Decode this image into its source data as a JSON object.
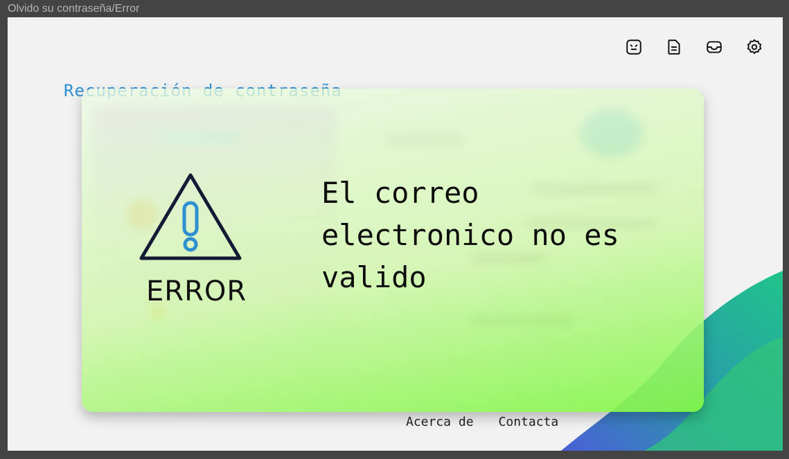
{
  "window": {
    "title": "Olvido su contraseña/Error"
  },
  "toolbar": {
    "icons": [
      "face-icon",
      "document-icon",
      "inbox-icon",
      "settings-gear-icon"
    ]
  },
  "page": {
    "title": "Recuperación de contraseña"
  },
  "modal": {
    "error_label": "ERROR",
    "message": "El correo electronico no es valido",
    "icon": "warning-triangle-icon",
    "colors": {
      "gradient_start": "#ecfae4",
      "gradient_end": "#82f746",
      "icon_accent": "#2e8fd1"
    }
  },
  "footer": {
    "about": "Acerca de",
    "contact": "Contacta"
  }
}
